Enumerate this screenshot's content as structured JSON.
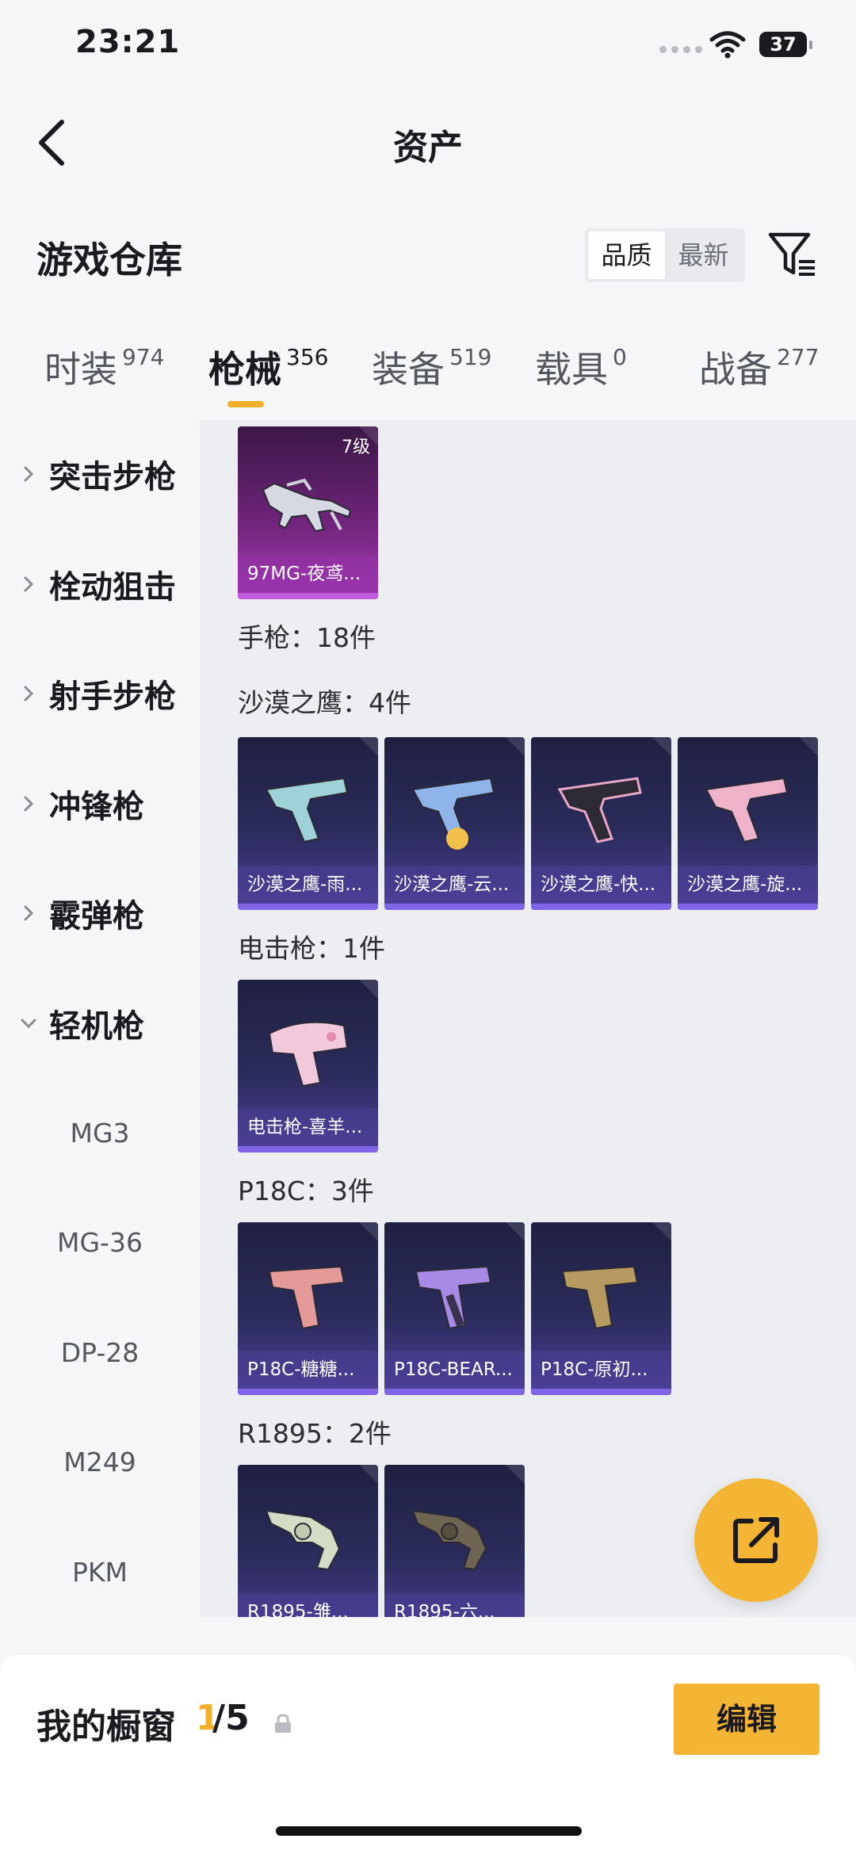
{
  "status_bar": {
    "time": "23:21",
    "battery": "37"
  },
  "header": {
    "title": "资产"
  },
  "warehouse": {
    "title": "游戏仓库",
    "sort_options": [
      "品质",
      "最新"
    ],
    "sort_selected": "品质"
  },
  "tabs": [
    {
      "label": "时装",
      "count": "974"
    },
    {
      "label": "枪械",
      "count": "356",
      "active": true
    },
    {
      "label": "装备",
      "count": "519"
    },
    {
      "label": "载具",
      "count": "0"
    },
    {
      "label": "战备",
      "count": "277"
    }
  ],
  "sidebar": {
    "categories": [
      "突击步枪",
      "栓动狙击",
      "射手步枪",
      "冲锋枪",
      "霰弹枪",
      "轻机枪"
    ],
    "expanded_subitems": [
      "MG3",
      "MG-36",
      "DP-28",
      "M249",
      "PKM"
    ]
  },
  "items": {
    "top_card": {
      "name": "97MG-夜鸢...",
      "level": "7级"
    },
    "pistol_label": "手枪：18件",
    "groups": [
      {
        "label": "沙漠之鹰：4件",
        "cards": [
          "沙漠之鹰-雨...",
          "沙漠之鹰-云...",
          "沙漠之鹰-快...",
          "沙漠之鹰-旋..."
        ]
      },
      {
        "label": "电击枪：1件",
        "cards": [
          "电击枪-喜羊..."
        ]
      },
      {
        "label": "P18C：3件",
        "cards": [
          "P18C-糖糖...",
          "P18C-BEAR...",
          "P18C-原初..."
        ]
      },
      {
        "label": "R1895：2件",
        "cards": [
          "R1895-雏...",
          "R1895-六..."
        ]
      }
    ]
  },
  "bottom_bar": {
    "showcase_label": "我的橱窗",
    "current": "1",
    "total": "/5",
    "edit_label": "编辑"
  },
  "colors": {
    "accent": "#f3b533",
    "epic_purple": "#8066e6",
    "legend_pink": "#c35de0"
  }
}
